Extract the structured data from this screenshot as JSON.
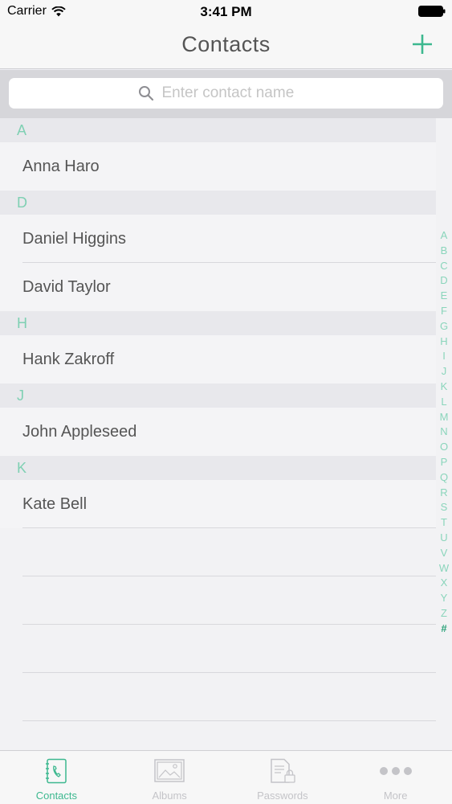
{
  "status": {
    "carrier": "Carrier",
    "time": "3:41 PM"
  },
  "nav": {
    "title": "Contacts"
  },
  "search": {
    "placeholder": "Enter contact name"
  },
  "sections": [
    {
      "letter": "A",
      "contacts": [
        "Anna Haro"
      ]
    },
    {
      "letter": "D",
      "contacts": [
        "Daniel Higgins",
        "David Taylor"
      ]
    },
    {
      "letter": "H",
      "contacts": [
        "Hank Zakroff"
      ]
    },
    {
      "letter": "J",
      "contacts": [
        "John Appleseed"
      ]
    },
    {
      "letter": "K",
      "contacts": [
        "Kate Bell"
      ]
    }
  ],
  "index": [
    "A",
    "B",
    "C",
    "D",
    "E",
    "F",
    "G",
    "H",
    "I",
    "J",
    "K",
    "L",
    "M",
    "N",
    "O",
    "P",
    "Q",
    "R",
    "S",
    "T",
    "U",
    "V",
    "W",
    "X",
    "Y",
    "Z",
    "#"
  ],
  "tabs": [
    {
      "label": "Contacts",
      "icon": "phone-book-icon",
      "active": true
    },
    {
      "label": "Albums",
      "icon": "photo-album-icon",
      "active": false
    },
    {
      "label": "Passwords",
      "icon": "password-document-icon",
      "active": false
    },
    {
      "label": "More",
      "icon": "more-dots-icon",
      "active": false
    }
  ],
  "colors": {
    "accent": "#3db88f",
    "section_letter": "#7fd0b3"
  }
}
